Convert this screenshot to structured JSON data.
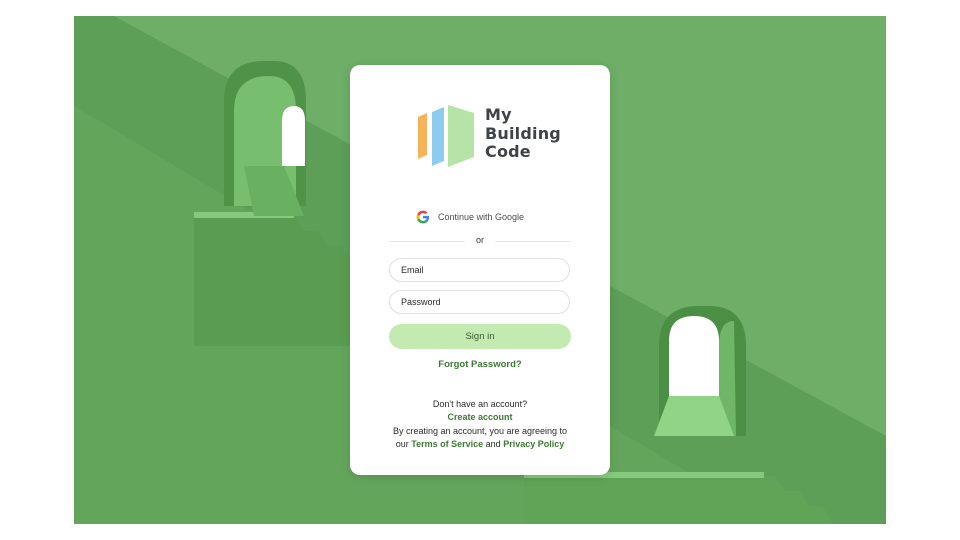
{
  "brand": {
    "name_line1": "My",
    "name_line2": "Building",
    "name_line3": "Code",
    "colors": {
      "orange": "#f6b35a",
      "blue": "#8ecbf0",
      "green": "#b6e3a6"
    }
  },
  "auth": {
    "google_label": "Continue with Google",
    "or_label": "or",
    "email_placeholder": "Email",
    "password_placeholder": "Password",
    "signin_label": "Sign in",
    "forgot_label": "Forgot Password?",
    "no_account_text": "Don't have an account?",
    "create_account_label": "Create account",
    "agree_text": "By creating an account, you are agreeing to",
    "our_text": "our",
    "terms_label": "Terms of Service",
    "and_text": "and",
    "privacy_label": "Privacy Policy"
  },
  "theme": {
    "background": "#6aab63",
    "accent": "#3d7a33",
    "button": "#c3ebb1"
  }
}
